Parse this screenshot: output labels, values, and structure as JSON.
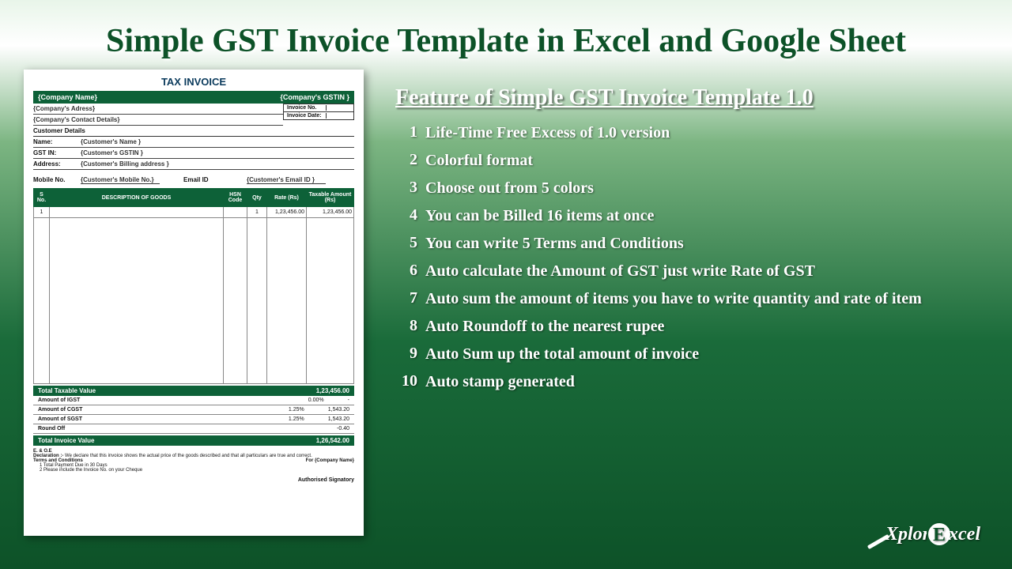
{
  "title": "Simple GST Invoice Template in Excel and Google Sheet",
  "features_title": "Feature of Simple GST Invoice Template 1.0",
  "features": [
    {
      "num": "1",
      "text": "Life-Time Free Excess of 1.0 version"
    },
    {
      "num": "2",
      "text": "Colorful format"
    },
    {
      "num": "3",
      "text": "Choose out from 5 colors"
    },
    {
      "num": "4",
      "text": "You can be Billed 16 items at once"
    },
    {
      "num": "5",
      "text": "You can write 5 Terms and Conditions"
    },
    {
      "num": "6",
      "text": "Auto calculate the Amount of GST just write Rate of GST"
    },
    {
      "num": "7",
      "text": "Auto sum the amount of items you have to write quantity and rate of item"
    },
    {
      "num": "8",
      "text": "Auto Roundoff to the nearest rupee"
    },
    {
      "num": "9",
      "text": "Auto Sum up the total amount of invoice"
    },
    {
      "num": "10",
      "text": "Auto stamp generated"
    }
  ],
  "invoice": {
    "doc_title": "TAX INVOICE",
    "company": "{Company Name}",
    "gstin_label": "{Company's GSTIN }",
    "address": "{Company's Adress}",
    "contact": "{Company's Contact Details}",
    "inv_no_label": "Invoice No.",
    "inv_date_label": "Invoice Date:",
    "customer_section": "Customer Details",
    "cust_name_label": "Name:",
    "cust_name": "{Customer's Name }",
    "cust_gstin_label": "GST IN:",
    "cust_gstin": "{Customer's GSTIN }",
    "cust_addr_label": "Address:",
    "cust_addr": "{Customer's Billing address }",
    "cust_mobile_label": "Mobile No.",
    "cust_mobile": "{Customer's Mobile No.}",
    "cust_email_label": "Email ID",
    "cust_email": "{Customer's Email ID }",
    "cols": {
      "sno": "S No.",
      "desc": "DESCRIPTION OF GOODS",
      "hsn": "HSN Code",
      "qty": "Qty",
      "rate": "Rate (Rs)",
      "amount": "Taxable Amount (Rs)"
    },
    "row1": {
      "sno": "1",
      "qty": "1",
      "rate": "1,23,456.00",
      "amount": "1,23,456.00"
    },
    "total_taxable_label": "Total Taxable Value",
    "total_taxable": "1,23,456.00",
    "igst_label": "Amount of IGST",
    "igst_pct": "0.00%",
    "igst_val": "-",
    "cgst_label": "Amount of CGST",
    "cgst_pct": "1.25%",
    "cgst_val": "1,543.20",
    "sgst_label": "Amount of SGST",
    "sgst_pct": "1.25%",
    "sgst_val": "1,543.20",
    "roundoff_label": "Round Off",
    "roundoff_val": "-0.40",
    "total_invoice_label": "Total Invoice Value",
    "total_invoice": "1,26,542.00",
    "eoe": "E. & O.E",
    "declaration_label": "Declaration :-",
    "declaration": "We declare that this invoice shows the actual price of the goods described and that all particulars are true and correct.",
    "terms_label": "Terms and Conditions",
    "term1": "1  Total Payment Due in 30 Days",
    "term2": "2  Please include the Invoice No. on your Cheque",
    "for_company": "For {Company Name}",
    "signatory": "Authorised Signatory"
  },
  "logo": {
    "part1": "Xplor",
    "part2": "E",
    "part3": "xcel"
  }
}
